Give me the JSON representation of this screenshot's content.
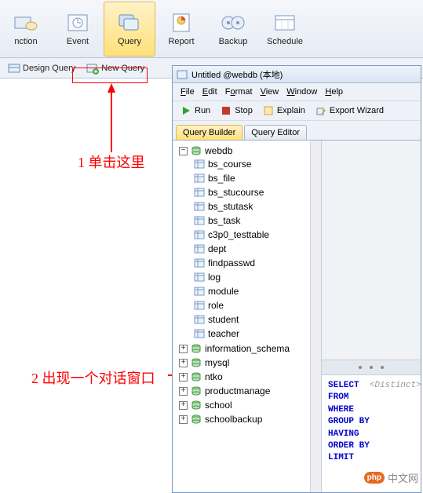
{
  "toolbar": [
    {
      "id": "connection",
      "label": "nction"
    },
    {
      "id": "event",
      "label": "Event"
    },
    {
      "id": "query",
      "label": "Query",
      "active": true
    },
    {
      "id": "report",
      "label": "Report"
    },
    {
      "id": "backup",
      "label": "Backup"
    },
    {
      "id": "schedule",
      "label": "Schedule"
    }
  ],
  "subToolbar": {
    "design": "Design Query",
    "new": "New Query"
  },
  "annotations": {
    "a1": "1 单击这里",
    "a2": "2 出现一个对话窗口"
  },
  "window": {
    "title": "Untitled @webdb (本地)",
    "menus": {
      "file": "File",
      "edit": "Edit",
      "format": "Format",
      "view": "View",
      "window": "Window",
      "help": "Help"
    },
    "actions": {
      "run": "Run",
      "stop": "Stop",
      "explain": "Explain",
      "export": "Export Wizard"
    },
    "tabs": {
      "builder": "Query Builder",
      "editor": "Query Editor"
    },
    "tree": {
      "dbs": [
        {
          "name": "webdb",
          "expanded": true,
          "tables": [
            "bs_course",
            "bs_file",
            "bs_stucourse",
            "bs_stutask",
            "bs_task",
            "c3p0_testtable",
            "dept",
            "findpasswd",
            "log",
            "module",
            "role",
            "student",
            "teacher"
          ]
        },
        {
          "name": "information_schema",
          "expanded": false
        },
        {
          "name": "mysql",
          "expanded": false
        },
        {
          "name": "ntko",
          "expanded": false
        },
        {
          "name": "productmanage",
          "expanded": false
        },
        {
          "name": "school",
          "expanded": false
        },
        {
          "name": "schoolbackup",
          "expanded": false
        }
      ]
    },
    "sql": {
      "k1": "SELECT",
      "d1": "<Distinct>",
      "k2": "FROM",
      "k3": "WHERE",
      "k4": "GROUP BY",
      "k5": "HAVING",
      "k6": "ORDER BY",
      "k7": "LIMIT"
    }
  },
  "watermark": {
    "php": "php",
    "text": "中文网"
  }
}
